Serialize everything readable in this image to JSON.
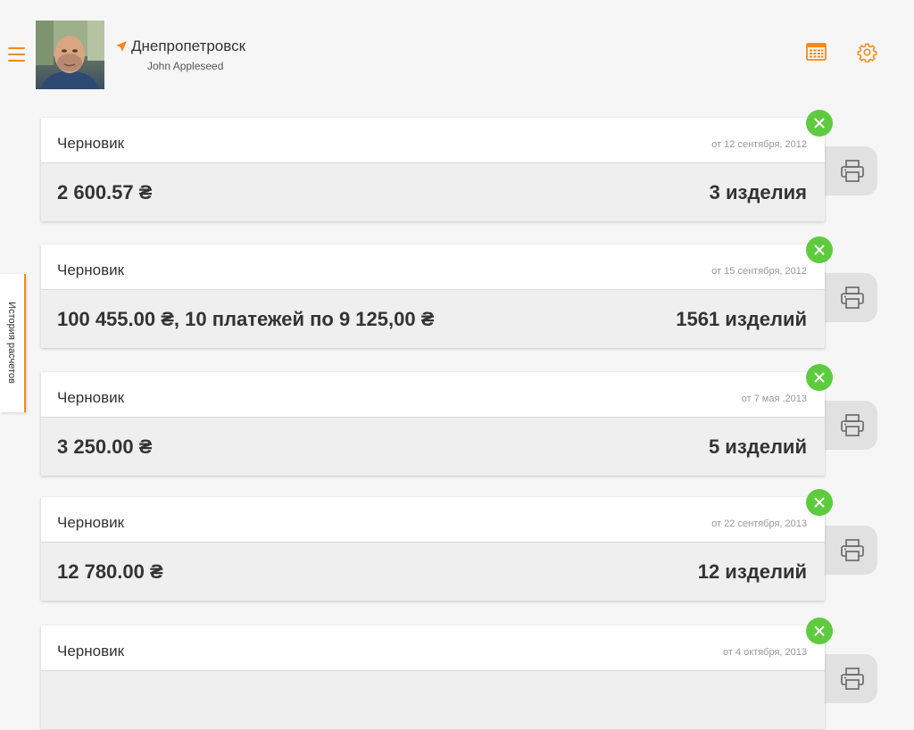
{
  "header": {
    "city": "Днепропетровск",
    "user_name": "John Appleseed"
  },
  "side_tab": {
    "label": "История расчетов"
  },
  "colors": {
    "accent": "#f08a1c",
    "close": "#5ecb3f",
    "card_bottom": "#efefef"
  },
  "icons": {
    "menu": "menu-icon",
    "location": "location-arrow-icon",
    "calendar": "calendar-icon",
    "settings": "gear-icon",
    "close": "close-icon",
    "print": "printer-icon"
  },
  "calculations": [
    {
      "status": "Черновик",
      "date": "от 12 сентября, 2012",
      "amount": "2 600.57 ₴",
      "items": "3 изделия"
    },
    {
      "status": "Черновик",
      "date": "от 15 сентября, 2012",
      "amount": "100 455.00 ₴, 10 платежей по 9 125,00 ₴",
      "items": "1561 изделий"
    },
    {
      "status": "Черновик",
      "date": "от 7 мая ,2013",
      "amount": "3 250.00 ₴",
      "items": "5 изделий"
    },
    {
      "status": "Черновик",
      "date": "от 22 сентября, 2013",
      "amount": "12 780.00 ₴",
      "items": "12 изделий"
    },
    {
      "status": "Черновик",
      "date": "от 4 октября, 2013",
      "amount": "",
      "items": ""
    }
  ]
}
